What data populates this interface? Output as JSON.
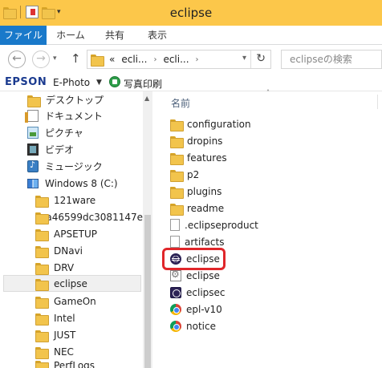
{
  "window": {
    "title": "eclipse"
  },
  "ribbon": {
    "tabs": [
      "ファイル",
      "ホーム",
      "共有",
      "表示"
    ]
  },
  "address": {
    "crumbs": [
      "«",
      "ecli...",
      "ecli..."
    ],
    "search_placeholder": "eclipseの検索"
  },
  "toolbar": {
    "brand": "EPSON",
    "app": "E-Photo",
    "print_label": "写真印刷"
  },
  "sidebar": {
    "items": [
      {
        "label": "デスクトップ",
        "icon": "folder-icon"
      },
      {
        "label": "ドキュメント",
        "icon": "documents-icon"
      },
      {
        "label": "ピクチャ",
        "icon": "pictures-icon"
      },
      {
        "label": "ビデオ",
        "icon": "videos-icon"
      },
      {
        "label": "ミュージック",
        "icon": "music-icon"
      },
      {
        "label": "Windows 8 (C:)",
        "icon": "drive-icon"
      },
      {
        "label": "121ware",
        "icon": "folder-icon"
      },
      {
        "label": "a46599dc3081147e",
        "icon": "folder-icon"
      },
      {
        "label": "APSETUP",
        "icon": "folder-icon"
      },
      {
        "label": "DNavi",
        "icon": "folder-icon"
      },
      {
        "label": "DRV",
        "icon": "folder-icon"
      },
      {
        "label": "eclipse",
        "icon": "folder-icon",
        "selected": true
      },
      {
        "label": "GameOn",
        "icon": "folder-icon"
      },
      {
        "label": "Intel",
        "icon": "folder-icon"
      },
      {
        "label": "JUST",
        "icon": "folder-icon"
      },
      {
        "label": "NEC",
        "icon": "folder-icon"
      },
      {
        "label": "PerfLogs",
        "icon": "folder-icon"
      }
    ]
  },
  "file_list": {
    "column_name": "名前",
    "files": [
      {
        "name": "configuration",
        "type": "folder"
      },
      {
        "name": "dropins",
        "type": "folder"
      },
      {
        "name": "features",
        "type": "folder"
      },
      {
        "name": "p2",
        "type": "folder"
      },
      {
        "name": "plugins",
        "type": "folder"
      },
      {
        "name": "readme",
        "type": "folder"
      },
      {
        "name": ".eclipseproduct",
        "type": "file"
      },
      {
        "name": "artifacts",
        "type": "file"
      },
      {
        "name": "eclipse",
        "type": "eclipse-exe",
        "highlighted": true
      },
      {
        "name": "eclipse",
        "type": "ini"
      },
      {
        "name": "eclipsec",
        "type": "exe"
      },
      {
        "name": "epl-v10",
        "type": "chrome-html"
      },
      {
        "name": "notice",
        "type": "chrome-html"
      }
    ]
  },
  "colors": {
    "titlebar": "#fcc74a",
    "file_tab": "#1979ca",
    "highlight": "#e0262a"
  }
}
